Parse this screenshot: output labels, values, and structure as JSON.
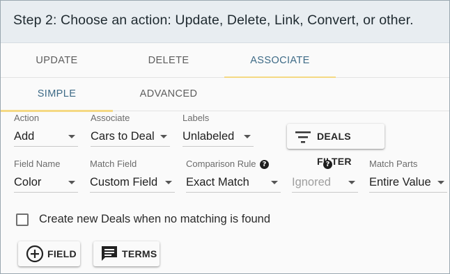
{
  "header": {
    "title": "Step 2: Choose an action: Update, Delete, Link, Convert, or other."
  },
  "main_tabs": [
    {
      "label": "UPDATE",
      "active": false
    },
    {
      "label": "DELETE",
      "active": false
    },
    {
      "label": "ASSOCIATE",
      "active": true
    }
  ],
  "sub_tabs": [
    {
      "label": "SIMPLE",
      "active": true
    },
    {
      "label": "ADVANCED",
      "active": false
    }
  ],
  "row1": {
    "action": {
      "label": "Action",
      "value": "Add"
    },
    "associate": {
      "label": "Associate",
      "value": "Cars to Deal"
    },
    "labels": {
      "label": "Labels",
      "value": "Unlabeled"
    },
    "filter_button": {
      "label": "DEALS FILTER",
      "icon": "filter-icon"
    }
  },
  "row2": {
    "field_name": {
      "label": "Field Name",
      "value": "Color"
    },
    "match_field": {
      "label": "Match Field",
      "value": "Custom Field"
    },
    "comparison_rule": {
      "label": "Comparison Rule",
      "value": "Exact Match",
      "help": "?"
    },
    "unnamed": {
      "label": "",
      "value": "Ignored",
      "help": "?"
    },
    "match_parts": {
      "label": "Match Parts",
      "value": "Entire Value"
    }
  },
  "create_new": {
    "label": "Create new Deals when no matching is found",
    "checked": false
  },
  "buttons": {
    "field": {
      "label": "FIELD",
      "icon": "add-circle-icon"
    },
    "terms": {
      "label": "TERMS",
      "icon": "comment-icon"
    }
  },
  "colors": {
    "accent_underline": "#f5d983",
    "active_tab_text": "#3d6a86",
    "header_bg": "#e8edf1"
  }
}
